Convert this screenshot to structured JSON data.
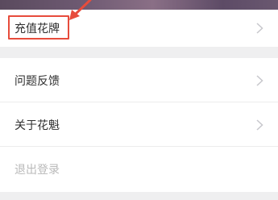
{
  "menu": {
    "recharge_label": "充值花牌",
    "feedback_label": "问题反馈",
    "about_label": "关于花魁",
    "logout_label": "退出登录"
  },
  "colors": {
    "highlight": "#e74c3c",
    "background": "#efeff0",
    "chevron": "#c7c7cc"
  },
  "icons": {
    "chevron": "chevron-right-icon",
    "annotation_arrow": "arrow-icon"
  }
}
